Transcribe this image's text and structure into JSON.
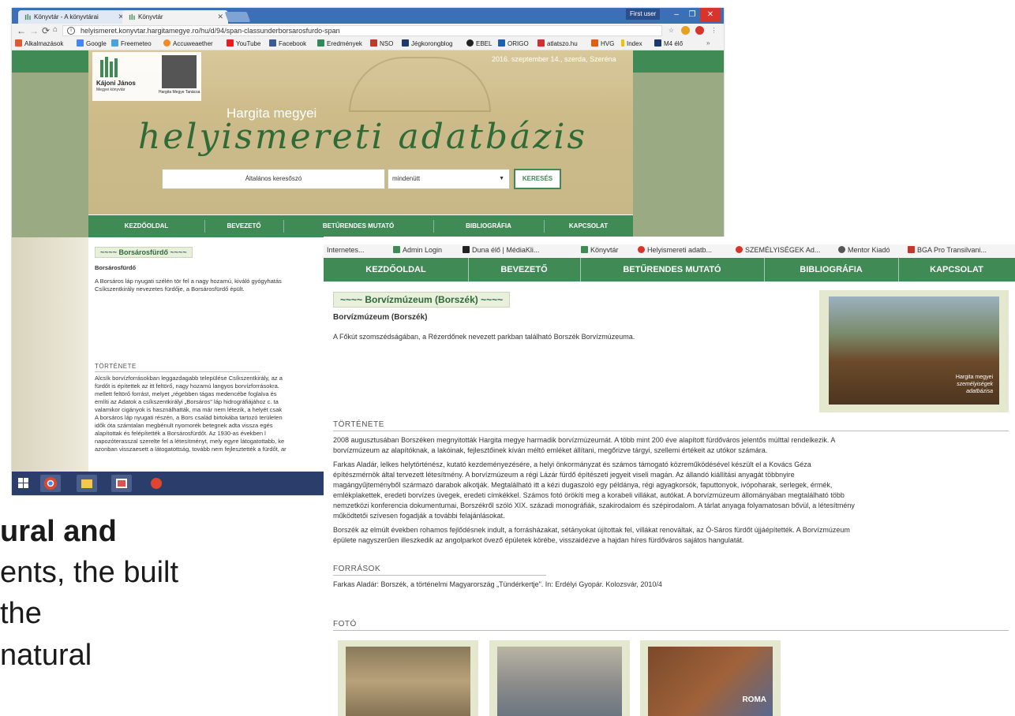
{
  "slide": {
    "line1": "ural and",
    "line2": "ents, the built",
    "line3": "the",
    "line4": " natural"
  },
  "window1": {
    "tabs": [
      {
        "label": "Könyvtár - A könyvtárai"
      },
      {
        "label": "Könyvtár"
      }
    ],
    "first_user": "First user",
    "url": "helyismeret.konyvtar.hargitamegye.ro/hu/d/94/span-classunderborsarosfurdo-span",
    "bookmarks": [
      "Alkalmazások",
      "Google",
      "Freemeteo",
      "Accuweaether",
      "YouTube",
      "Facebook",
      "Eredmények",
      "NSO",
      "Jégkorongblog",
      "EBEL",
      "ORIGO",
      "atlatszo.hu",
      "HVG",
      "Index",
      "M4 élő"
    ],
    "logo": {
      "name": "Kájoni János",
      "sub": "Megyei könyvtár",
      "partner": "Hargita Megye Tanácsa"
    },
    "date": "2016. szeptember  14., szerda,  Szeréna",
    "hargita": "Hargita megyei",
    "title_script": "helyismereti adatbázis",
    "search": {
      "placeholder": "Általános keresőszó",
      "select": "mindenütt",
      "button": "KERESÉS"
    },
    "nav": [
      "KEZDŐOLDAL",
      "BEVEZETŐ",
      "BETŰRENDES MUTATÓ",
      "BIBLIOGRÁFIA",
      "KAPCSOLAT"
    ],
    "section_title": "Borsárosfürdő",
    "heading": "Borsárosfürdő",
    "intro": [
      "A Borsáros láp nyugati szélén tör fel a nagy hozamú, kiváló gyógyhatás",
      "Csíkszentkirály nevezetes fürdője, a Borsárosfürdő épült."
    ],
    "tortenete": "TÖRTÉNETE",
    "history": [
      "Alcsík borvízforrásokban leggazdagabb települése Csíkszentkirály, az a",
      "fürdőt is építettek az itt feltörő, nagy hozamú langyos borvízforrásokra.",
      "mellett feltörő forrást, melyet „régebben tágas medencébe foglalva és",
      "említi az Adatok a csíkszentkirályi „Borsáros\" láp hidrográfiájához c. ta",
      "valamikor cigányok is használhatták, ma már nem létezik, a helyét csak",
      "A borsáros láp nyugati részén, a Bors család birtokába tartozó területen",
      "idők óta számtalan megbénult nyomorék betegnek adta vissza egés",
      "alapítottak és felépítették a Borsárosfürdőt. Az 1930-as években l",
      "napozóterasszal szerelte fel a létesítményt, mely egyre látogatottabb, ke",
      "azonban visszaesett a látogatottság, tovább nem fejlesztették a fürdőt, ar"
    ]
  },
  "window2": {
    "bookmarks": [
      "Internetes...",
      "Admin Login",
      "Duna élő | MédiaKli...",
      "Könyvtár",
      "Helyismereti adatb...",
      "SZEMÉLYISÉGEK Ad...",
      "Mentor Kiadó",
      "BGA Pro Transilvani..."
    ],
    "nav": [
      "KEZDŐOLDAL",
      "BEVEZETŐ",
      "BETŰRENDES MUTATÓ",
      "BIBLIOGRÁFIA",
      "KAPCSOLAT"
    ],
    "section_title": "Borvízmúzeum (Borszék)",
    "heading": "Borvízmúzeum (Borszék)",
    "intro": "A Főkút szomszédságában, a Rézerdőnek nevezett parkban található Borszék Borvízmúzeuma.",
    "photo_watermark": [
      "Hargita megyei",
      "személyiségek",
      "adatbázisa"
    ],
    "tortenete": "TÖRTÉNETE",
    "history": [
      "2008 augusztusában Borszéken megnyitották Hargita megye harmadik borvízmúzeumát. A több mint 200 éve alapított fürdőváros jelentős múlttal rendelkezik. A",
      "borvízmúzeum az alapítóknak, a lakóinak, fejlesztőinek kíván méltó emléket állítani, megőrizve tárgyi, szellemi értékeit az utókor számára.",
      "Farkas Aladár, lelkes helytörténész, kutató kezdeményezésére, a helyi önkormányzat és számos támogató közreműködésével készült el a Kovács Géza",
      "építészmérnök által tervezett létesítmény. A borvízmúzeum a régi Lázár fürdő építészeti jegyeit viseli magán. Az állandó kiállítási anyagát többnyire",
      "magángyűjteményből származó darabok alkotják. Megtalálható itt a kézi dugaszoló egy példánya, régi agyagkorsók, faputtonyok, ivópoharak, serlegek, érmék,",
      "emlékplakettek, eredeti borvízes üvegek, eredeti címkékkel. Számos fotó örökíti meg a korabeli villákat, autókat. A borvízmúzeum állományában megtalálható több",
      "nemzetközi konferencia dokumentumai, Borszékről szóló XIX. századi monográfiák, szakirodalom és szépirodalom. A tárlat anyaga folyamatosan bővül, a létesítmény",
      "működtetői szívesen fogadják a további felajánlásokat.",
      "Borszék az elmúlt években rohamos fejlődésnek indult, a forrásházakat, sétányokat újítottak fel, villákat renováltak, az Ó-Sáros fürdőt újjáépítették. A Borvízmúzeum",
      "épülete nagyszerűen illeszkedik az angolparkot övező épületek körébe, visszaidézve a hajdan híres fürdőváros sajátos hangulatát."
    ],
    "forrasok": "FORRÁSOK",
    "source": "Farkas Aladár: Borszék, a történelmi Magyarország „Tündérkertje\". In: Erdélyi Gyopár. Kolozsvár, 2010/4",
    "foto": "FOTÓ",
    "thumb_text": "ROMA"
  }
}
